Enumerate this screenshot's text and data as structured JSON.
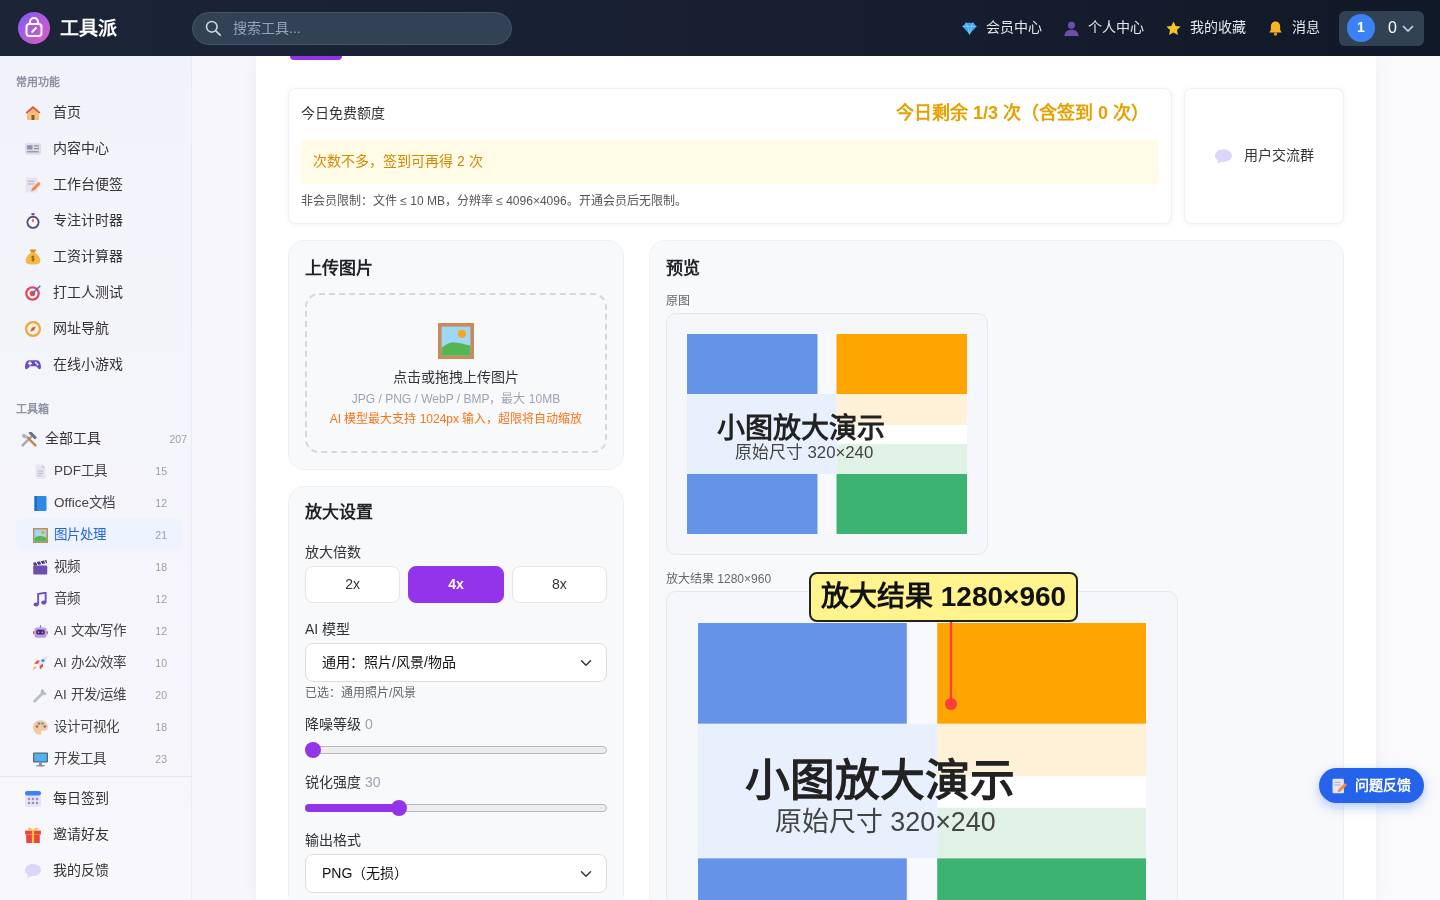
{
  "navbar": {
    "brand": "工具派",
    "search": {
      "placeholder": "搜索工具..."
    },
    "links": [
      {
        "label": "会员中心"
      },
      {
        "label": "个人中心"
      },
      {
        "label": "我的收藏"
      },
      {
        "label": "消息"
      }
    ],
    "account": {
      "avatar": "1",
      "count": "0"
    }
  },
  "sidebar": {
    "sections": [
      {
        "title": "常用功能",
        "items": [
          {
            "label": "首页",
            "selected": false
          },
          {
            "label": "内容中心",
            "selected": false
          },
          {
            "label": "工作台便签",
            "selected": false
          },
          {
            "label": "专注计时器",
            "selected": false
          },
          {
            "label": "工资计算器",
            "selected": false
          },
          {
            "label": "打工人测试",
            "selected": false
          },
          {
            "label": "网址导航",
            "selected": false
          },
          {
            "label": "在线小游戏",
            "selected": false
          }
        ]
      },
      {
        "title": "工具箱",
        "items": [
          {
            "label": "全部工具",
            "count": "207",
            "selected": false,
            "children": [
              {
                "label": "PDF工具",
                "count": "15",
                "selected": false
              },
              {
                "label": "Office文档",
                "count": "12",
                "selected": false
              },
              {
                "label": "图片处理",
                "count": "21",
                "selected": true
              },
              {
                "label": "视频",
                "count": "18",
                "selected": false
              },
              {
                "label": "音频",
                "count": "12",
                "selected": false
              },
              {
                "label": "AI 文本/写作",
                "count": "12",
                "selected": false
              },
              {
                "label": "AI 办公/效率",
                "count": "10",
                "selected": false
              },
              {
                "label": "AI 开发/运维",
                "count": "20",
                "selected": false
              },
              {
                "label": "设计可视化",
                "count": "18",
                "selected": false
              },
              {
                "label": "开发工具",
                "count": "23",
                "selected": false
              }
            ]
          }
        ]
      }
    ],
    "footer_items": [
      {
        "label": "每日签到",
        "selected": false
      },
      {
        "label": "邀请好友",
        "selected": false
      },
      {
        "label": "我的反馈",
        "selected": false
      }
    ]
  },
  "quota": {
    "title": "今日免费额度",
    "remaining": "今日剩余 1/3 次（含签到 0 次）",
    "alert": "次数不多，签到可再得 2 次",
    "note": "非会员限制：文件 ≤ 10 MB，分辨率 ≤ 4096×4096。开通会员后无限制。"
  },
  "community": {
    "label": "用户交流群"
  },
  "upload": {
    "title": "上传图片",
    "prompt": "点击或拖拽上传图片",
    "formats": "JPG / PNG / WebP / BMP，最大 10MB",
    "warning": "AI 模型最大支持 1024px 输入，超限将自动缩放"
  },
  "settings": {
    "title": "放大设置",
    "scale": {
      "label": "放大倍数",
      "options": [
        {
          "label": "2x",
          "selected": false
        },
        {
          "label": "4x",
          "selected": true
        },
        {
          "label": "8x",
          "selected": false
        }
      ]
    },
    "model": {
      "label": "AI 模型",
      "value": "通用：照片/风景/物品",
      "hint": "已选：通用照片/风景"
    },
    "sliders": [
      {
        "label": "降噪等级",
        "reading": "0",
        "level": 0
      },
      {
        "label": "锐化强度",
        "reading": "30",
        "level": 0.3
      }
    ],
    "format": {
      "label": "输出格式",
      "value": "PNG（无损）"
    }
  },
  "preview": {
    "title": "预览",
    "original": {
      "label": "原图",
      "image_title": "小图放大演示",
      "image_caption": "原始尺寸 320×240"
    },
    "result": {
      "label": "放大结果 1280×960",
      "image_title": "小图放大演示",
      "image_caption": "原始尺寸 320×240",
      "callout": "放大结果 1280×960"
    }
  },
  "feedback_button": {
    "label": "问题反馈"
  }
}
